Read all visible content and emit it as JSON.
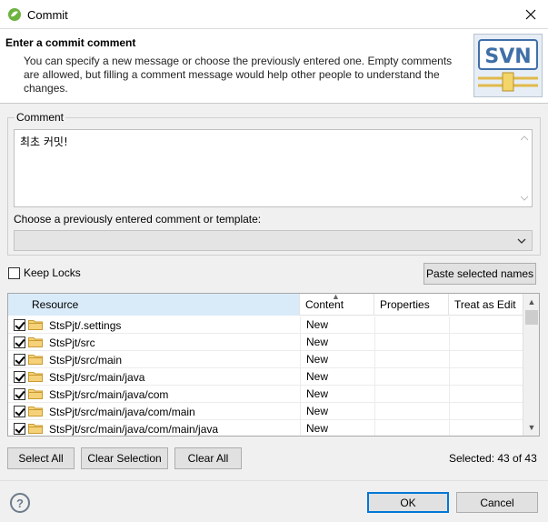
{
  "window": {
    "title": "Commit",
    "close_icon": "close-icon"
  },
  "header": {
    "title": "Enter a commit comment",
    "description": "You can specify a new message or choose the previously entered one. Empty comments are allowed, but filling a comment message would help other people to understand the changes.",
    "logo_text": "SVN"
  },
  "comment": {
    "group_label": "Comment",
    "value": "최초 커밋!",
    "choose_label": "Choose a previously entered comment or template:",
    "choose_value": ""
  },
  "keep_locks": {
    "label": "Keep Locks",
    "checked": false
  },
  "paste_button": "Paste selected names",
  "table": {
    "columns": [
      "Resource",
      "Content",
      "Properties",
      "Treat as Edit"
    ],
    "rows": [
      {
        "resource": "StsPjt/.settings",
        "content": "New",
        "checked": true
      },
      {
        "resource": "StsPjt/src",
        "content": "New",
        "checked": true
      },
      {
        "resource": "StsPjt/src/main",
        "content": "New",
        "checked": true
      },
      {
        "resource": "StsPjt/src/main/java",
        "content": "New",
        "checked": true
      },
      {
        "resource": "StsPjt/src/main/java/com",
        "content": "New",
        "checked": true
      },
      {
        "resource": "StsPjt/src/main/java/com/main",
        "content": "New",
        "checked": true
      },
      {
        "resource": "StsPjt/src/main/java/com/main/java",
        "content": "New",
        "checked": true
      }
    ]
  },
  "buttons": {
    "select_all": "Select All",
    "clear_selection": "Clear Selection",
    "clear_all": "Clear All",
    "ok": "OK",
    "cancel": "Cancel"
  },
  "status": {
    "selected": "Selected: 43 of 43"
  },
  "colors": {
    "accent": "#0078d7",
    "header_bg": "#ffffff",
    "selected_col": "#d9ebf9",
    "folder": "#e8b64a"
  }
}
